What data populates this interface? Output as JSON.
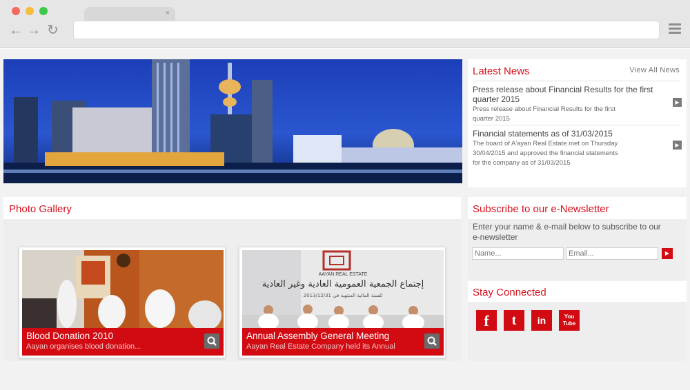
{
  "browser": {
    "tab_close": "×",
    "back": "←",
    "forward": "→",
    "reload": "↻"
  },
  "news": {
    "title": "Latest News",
    "view_all": "View All News",
    "items": [
      {
        "title": "Press release about Financial Results for the first quarter 2015",
        "desc": "Press release about Financial Results for the first quarter 2015"
      },
      {
        "title": "Financial statements as of 31/03/2015",
        "desc": "The board of A'ayan Real Estate met on Thursday 30/04/2015 and approved the financial statements for the company as of 31/03/2015"
      }
    ]
  },
  "gallery": {
    "title": "Photo Gallery",
    "items": [
      {
        "title": "Blood Donation 2010",
        "desc": "Aayan organises blood donation..."
      },
      {
        "title": "Annual Assembly General Meeting",
        "desc": "Aayan Real Estate Company held its Annual"
      }
    ],
    "banner_brand": "AAYAN REAL ESTATE",
    "banner_arabic": "إجتماع الجمعية العمومية العادية وغير العادية",
    "banner_arabic_sub": "للسنة المالية المنتهية في 2013/12/31"
  },
  "subscribe": {
    "title": "Subscribe to our e-Newsletter",
    "text": "Enter your name & e-mail below to subscribe to our e-newsletter",
    "name_placeholder": "Name...",
    "email_placeholder": "Email..."
  },
  "social": {
    "title": "Stay Connected",
    "facebook": "f",
    "twitter": "t",
    "linkedin": "in",
    "youtube": "You Tube"
  },
  "colors": {
    "accent": "#d20a12",
    "heading": "#d6101d"
  }
}
